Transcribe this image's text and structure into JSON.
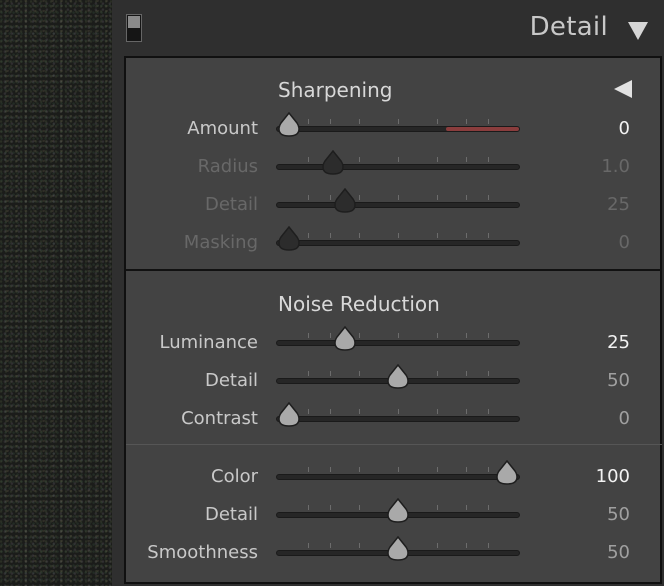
{
  "panel": {
    "title": "Detail",
    "solo_toggle_icon": "panel-switch-icon",
    "collapse_icon": "triangle-down-icon"
  },
  "sharpening": {
    "title": "Sharpening",
    "preview_icon": "triangle-left-icon",
    "sliders": [
      {
        "key": "amount",
        "label": "Amount",
        "value": "0",
        "fraction": 0.05,
        "state": "active",
        "track_color": "#8a3d3d"
      },
      {
        "key": "radius",
        "label": "Radius",
        "value": "1.0",
        "fraction": 0.23,
        "state": "dim"
      },
      {
        "key": "detail",
        "label": "Detail",
        "value": "25",
        "fraction": 0.28,
        "state": "dim"
      },
      {
        "key": "masking",
        "label": "Masking",
        "value": "0",
        "fraction": 0.05,
        "state": "dim"
      }
    ]
  },
  "noise_reduction": {
    "title": "Noise Reduction",
    "sliders": [
      {
        "key": "luminance",
        "label": "Luminance",
        "value": "25",
        "fraction": 0.28,
        "state": "active"
      },
      {
        "key": "lum-detail",
        "label": "Detail",
        "value": "50",
        "fraction": 0.5,
        "state": "mid"
      },
      {
        "key": "contrast",
        "label": "Contrast",
        "value": "0",
        "fraction": 0.05,
        "state": "mid"
      },
      {
        "key": "color",
        "label": "Color",
        "value": "100",
        "fraction": 0.95,
        "state": "active"
      },
      {
        "key": "color-detail",
        "label": "Detail",
        "value": "50",
        "fraction": 0.5,
        "state": "mid"
      },
      {
        "key": "smoothness",
        "label": "Smoothness",
        "value": "50",
        "fraction": 0.5,
        "state": "mid"
      }
    ]
  }
}
